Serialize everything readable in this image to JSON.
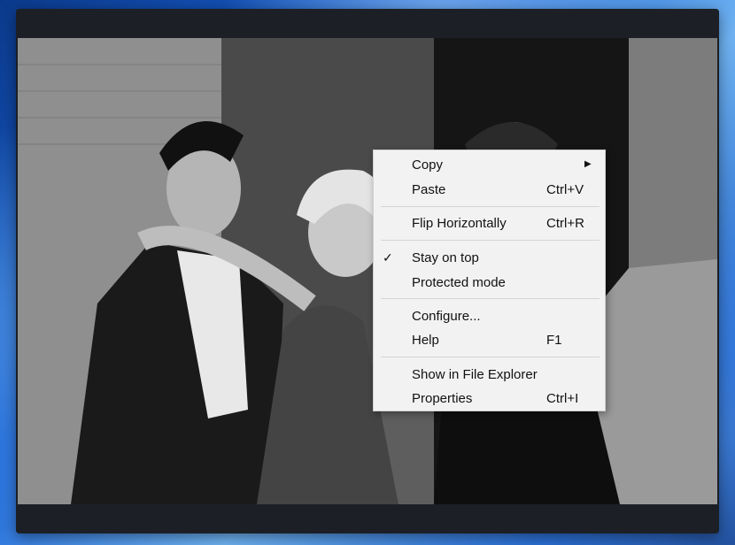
{
  "context_menu": {
    "items": [
      {
        "label": "Copy",
        "shortcut": "",
        "submenu": true
      },
      {
        "label": "Paste",
        "shortcut": "Ctrl+V"
      },
      {
        "label": "Flip Horizontally",
        "shortcut": "Ctrl+R"
      },
      {
        "label": "Stay on top",
        "shortcut": "",
        "checked": true
      },
      {
        "label": "Protected mode",
        "shortcut": ""
      },
      {
        "label": "Configure...",
        "shortcut": ""
      },
      {
        "label": "Help",
        "shortcut": "F1"
      },
      {
        "label": "Show in File Explorer",
        "shortcut": ""
      },
      {
        "label": "Properties",
        "shortcut": "Ctrl+I"
      }
    ],
    "check_glyph": "✓",
    "submenu_glyph": "▶"
  },
  "colors": {
    "menu_background": "#f2f2f2",
    "window_chrome": "#1c2026",
    "desktop_accent": "#1a63d6"
  },
  "icons": {
    "check": "checkmark-icon",
    "submenu": "chevron-right-icon"
  }
}
